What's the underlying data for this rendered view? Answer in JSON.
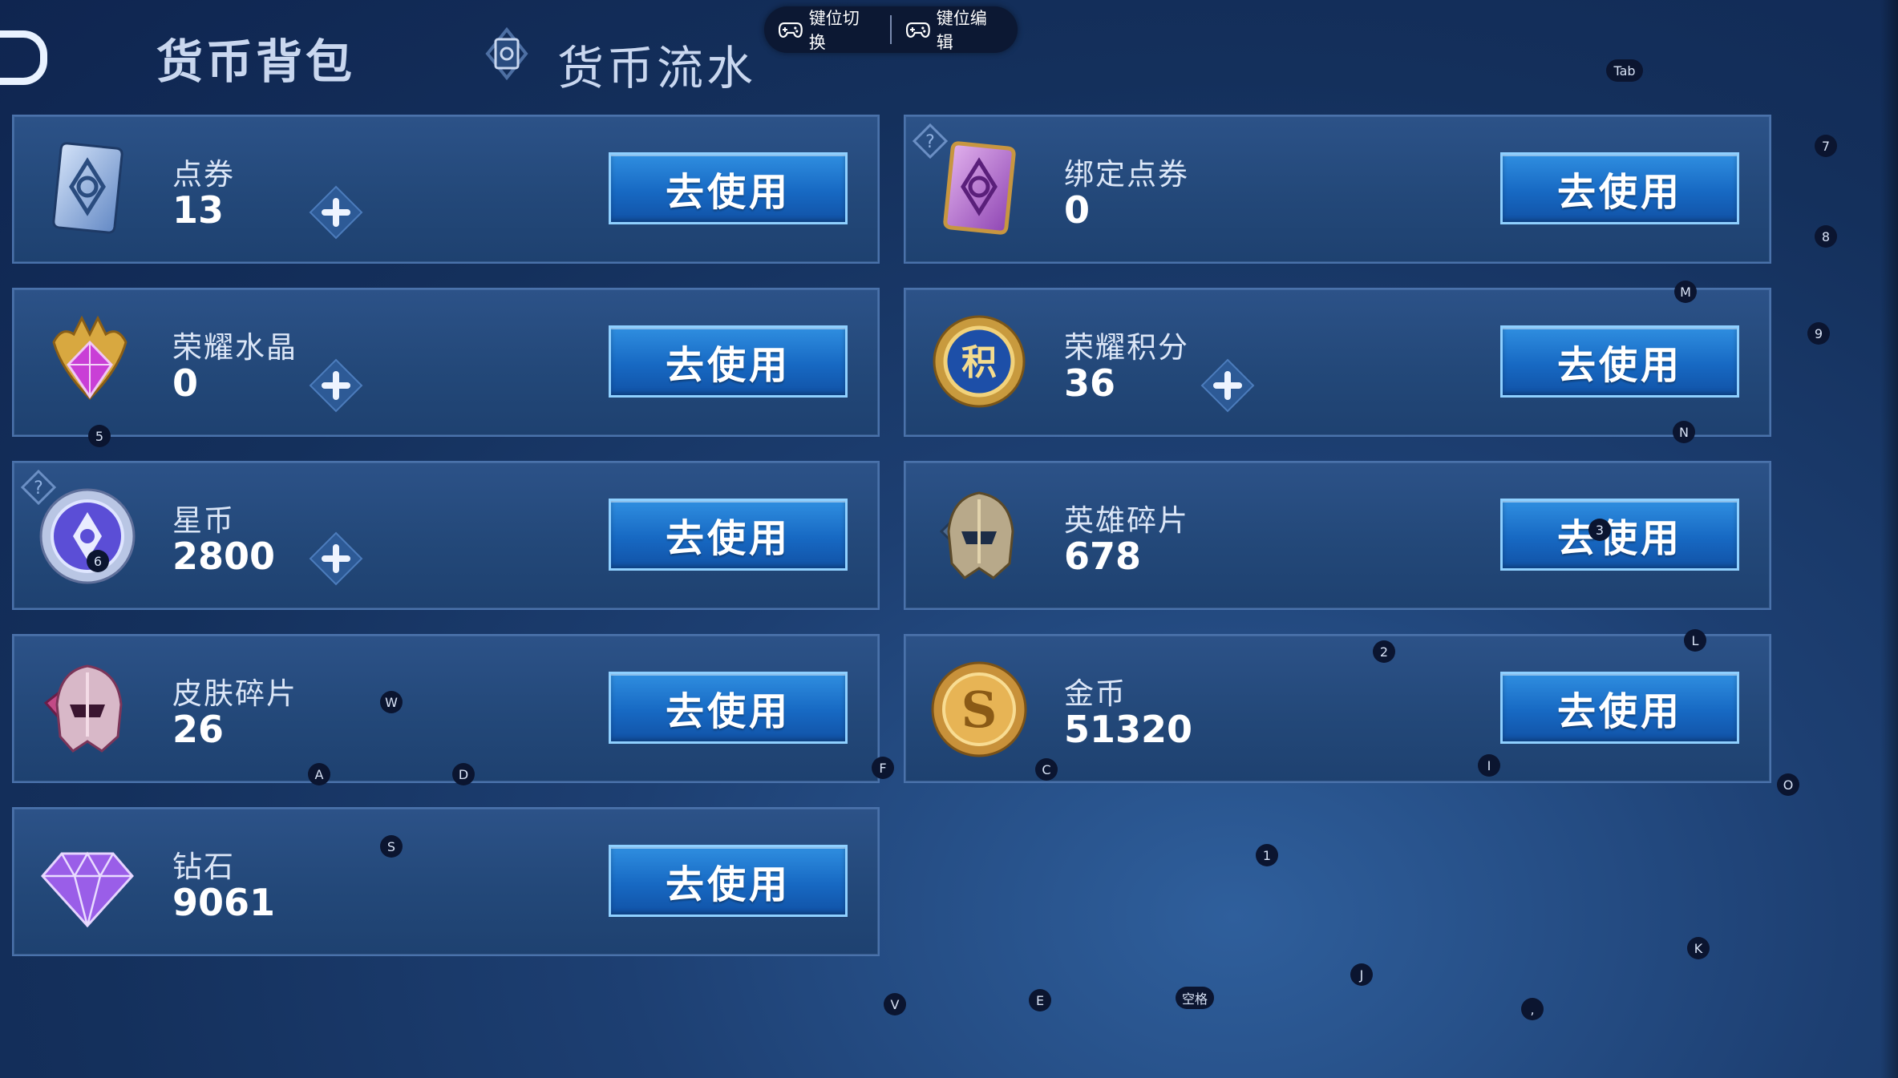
{
  "header": {
    "tab_wallet": "货币背包",
    "tab_flow": "货币流水",
    "key_switch": "键位切换",
    "key_edit": "键位编辑"
  },
  "use_label": "去使用",
  "currencies": [
    {
      "name": "点券",
      "value": "13"
    },
    {
      "name": "绑定点券",
      "value": "0"
    },
    {
      "name": "荣耀水晶",
      "value": "0"
    },
    {
      "name": "荣耀积分",
      "value": "36"
    },
    {
      "name": "星币",
      "value": "2800"
    },
    {
      "name": "英雄碎片",
      "value": "678"
    },
    {
      "name": "皮肤碎片",
      "value": "26"
    },
    {
      "name": "金币",
      "value": "51320"
    },
    {
      "name": "钻石",
      "value": "9061"
    }
  ],
  "key_hints": [
    "Tab",
    "7",
    "8",
    "M",
    "9",
    "5",
    "N",
    "6",
    "3",
    "2",
    "L",
    "W",
    "A",
    "D",
    "F",
    "C",
    "I",
    "O",
    "S",
    "1",
    "K",
    "J",
    "V",
    "E",
    "空格",
    ","
  ]
}
